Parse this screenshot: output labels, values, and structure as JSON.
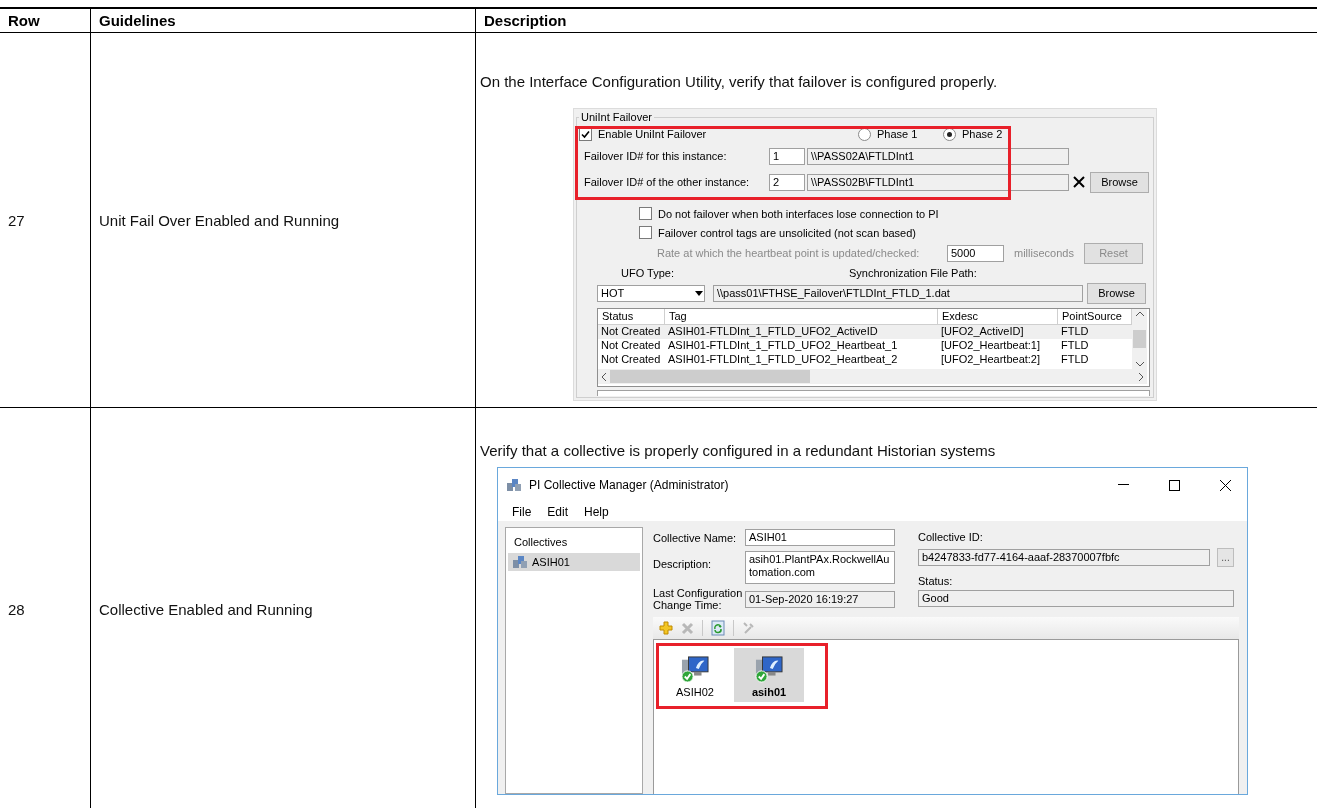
{
  "table": {
    "columns": [
      "Row",
      "Guidelines",
      "Description"
    ],
    "rows": [
      {
        "row": "27",
        "guideline": "Unit Fail Over Enabled and Running",
        "description": "On the Interface Configuration Utility, verify that failover is configured properly.",
        "screenshot": {
          "kind": "failover",
          "group_title": "UniInt Failover",
          "enable": {
            "label": "Enable UniInt Failover",
            "checked": true
          },
          "phases": [
            {
              "label": "Phase 1",
              "selected": false
            },
            {
              "label": "Phase 2",
              "selected": true
            }
          ],
          "ids": [
            {
              "label": "Failover ID# for this instance:",
              "id": "1",
              "path": "\\\\PASS02A\\FTLDInt1"
            },
            {
              "label": "Failover ID# of the other instance:",
              "id": "2",
              "path": "\\\\PASS02B\\FTLDInt1"
            }
          ],
          "browse": "Browse",
          "options": [
            {
              "label": "Do not failover when both interfaces lose connection to PI",
              "checked": false
            },
            {
              "label": "Failover control tags are unsolicited (not scan based)",
              "checked": false
            }
          ],
          "rate": {
            "label": "Rate at which the heartbeat point is updated/checked:",
            "value": "5000",
            "unit": "milliseconds",
            "button": "Reset",
            "disabled": true
          },
          "ufo_type": {
            "label": "UFO Type:",
            "value": "HOT"
          },
          "sync": {
            "label": "Synchronization File Path:",
            "value": "\\\\pass01\\FTHSE_Failover\\FTLDInt_FTLD_1.dat",
            "button": "Browse"
          },
          "tags": {
            "columns": [
              "Status",
              "Tag",
              "Exdesc",
              "PointSource"
            ],
            "rows": [
              {
                "cells": [
                  "Not Created",
                  "ASIH01-FTLDInt_1_FTLD_UFO2_ActiveID",
                  "[UFO2_ActiveID]",
                  "FTLD"
                ],
                "selected": true
              },
              {
                "cells": [
                  "Not Created",
                  "ASIH01-FTLDInt_1_FTLD_UFO2_Heartbeat_1",
                  "[UFO2_Heartbeat:1]",
                  "FTLD"
                ],
                "selected": false
              },
              {
                "cells": [
                  "Not Created",
                  "ASIH01-FTLDInt_1_FTLD_UFO2_Heartbeat_2",
                  "[UFO2_Heartbeat:2]",
                  "FTLD"
                ],
                "selected": false
              }
            ]
          }
        }
      },
      {
        "row": "28",
        "guideline": "Collective Enabled and Running",
        "description": "Verify that a collective is properly configured in a redundant Historian systems",
        "screenshot": {
          "kind": "collective",
          "title": "PI Collective Manager (Administrator)",
          "menu": [
            "File",
            "Edit",
            "Help"
          ],
          "tree": {
            "header": "Collectives",
            "items": [
              {
                "label": "ASIH01",
                "selected": true
              }
            ]
          },
          "name": {
            "label": "Collective Name:",
            "value": "ASIH01"
          },
          "desc": {
            "label": "Description:",
            "value": "asih01.PlantPAx.RockwellAutomation.com"
          },
          "last": {
            "label": "Last Configuration Change Time:",
            "value": "01-Sep-2020 16:19:27"
          },
          "cid": {
            "label": "Collective ID:",
            "value": "b4247833-fd77-4164-aaaf-28370007fbfc",
            "button": "..."
          },
          "status": {
            "label": "Status:",
            "value": "Good"
          },
          "servers": [
            {
              "name": "ASIH02",
              "selected": false
            },
            {
              "name": "asih01",
              "selected": true
            }
          ]
        }
      }
    ]
  }
}
